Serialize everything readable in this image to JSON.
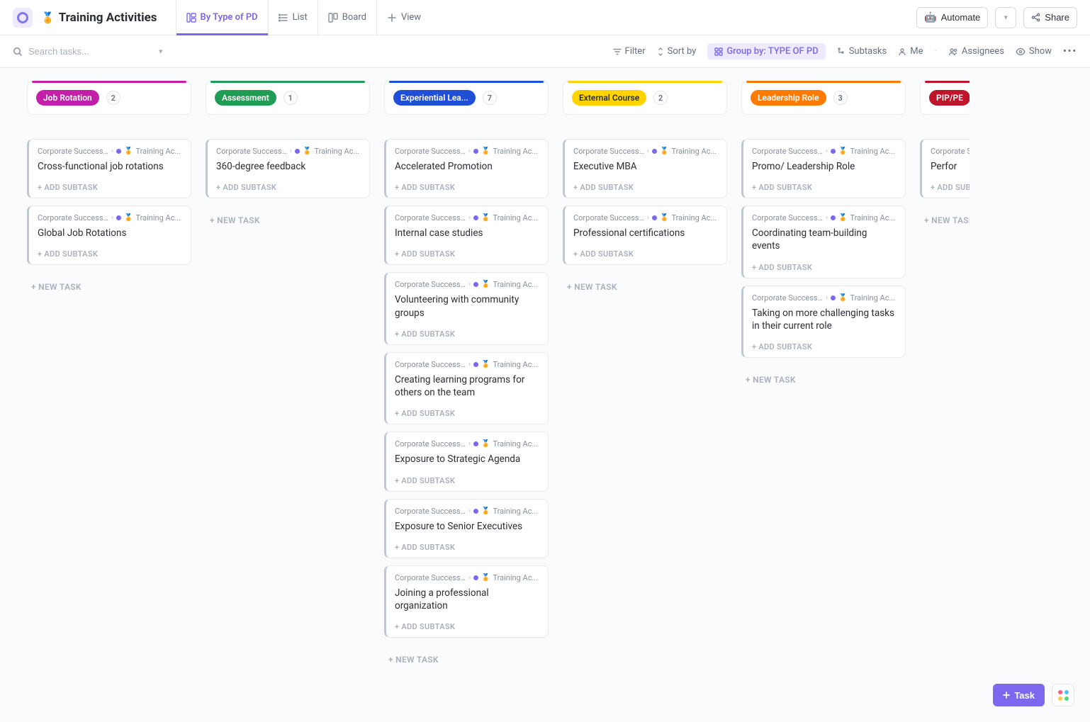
{
  "header": {
    "title": "Training Activities",
    "medal_emoji": "🏅",
    "views": [
      {
        "label": "By Type of PD",
        "icon": "board-grouped",
        "active": true
      },
      {
        "label": "List",
        "icon": "list"
      },
      {
        "label": "Board",
        "icon": "board"
      },
      {
        "label": "View",
        "icon": "plus"
      }
    ],
    "automate_label": "Automate",
    "share_label": "Share"
  },
  "toolbar": {
    "search_placeholder": "Search tasks...",
    "filter_label": "Filter",
    "sort_label": "Sort by",
    "group_label": "Group by: TYPE OF PD",
    "subtasks_label": "Subtasks",
    "me_label": "Me",
    "assignees_label": "Assignees",
    "show_label": "Show"
  },
  "breadcrumb": {
    "parent": "Corporate Succession ...",
    "child": "Training Ac..."
  },
  "labels": {
    "add_subtask": "+ ADD SUBTASK",
    "new_task": "+ NEW TASK",
    "task_button": "Task"
  },
  "columns": [
    {
      "name": "Job Rotation",
      "count": 2,
      "color_bg": "#c41fa9",
      "color_line": "#c41fa9",
      "cards": [
        {
          "title": "Cross-functional job rotations"
        },
        {
          "title": "Global Job Rotations"
        }
      ]
    },
    {
      "name": "Assessment",
      "count": 1,
      "color_bg": "#1f9d55",
      "color_line": "#1f9d55",
      "cards": [
        {
          "title": "360-degree feedback"
        }
      ]
    },
    {
      "name": "Experiential Lea...",
      "count": 7,
      "color_bg": "#1f4fd6",
      "color_line": "#1f4fd6",
      "cards": [
        {
          "title": "Accelerated Promotion"
        },
        {
          "title": "Internal case studies"
        },
        {
          "title": "Volunteering with community groups"
        },
        {
          "title": "Creating learning programs for others on the team"
        },
        {
          "title": "Exposure to Strategic Agenda"
        },
        {
          "title": "Exposure to Senior Executives"
        },
        {
          "title": "Joining a professional organization"
        }
      ]
    },
    {
      "name": "External Course",
      "count": 2,
      "color_bg": "#ffd400",
      "color_text": "#2a2e34",
      "color_line": "#ffd400",
      "cards": [
        {
          "title": "Executive MBA"
        },
        {
          "title": "Professional certifications"
        }
      ]
    },
    {
      "name": "Leadership Role",
      "count": 3,
      "color_bg": "#ff7a00",
      "color_line": "#ff7a00",
      "cards": [
        {
          "title": "Promo/ Leadership Role"
        },
        {
          "title": "Coordinating team-building events"
        },
        {
          "title": "Taking on more challenging tasks in their current role"
        }
      ]
    },
    {
      "name": "PIP/PE",
      "count": null,
      "color_bg": "#c0142b",
      "color_line": "#c0142b",
      "partial": true,
      "cards": [
        {
          "title": "Perfor"
        }
      ]
    }
  ]
}
